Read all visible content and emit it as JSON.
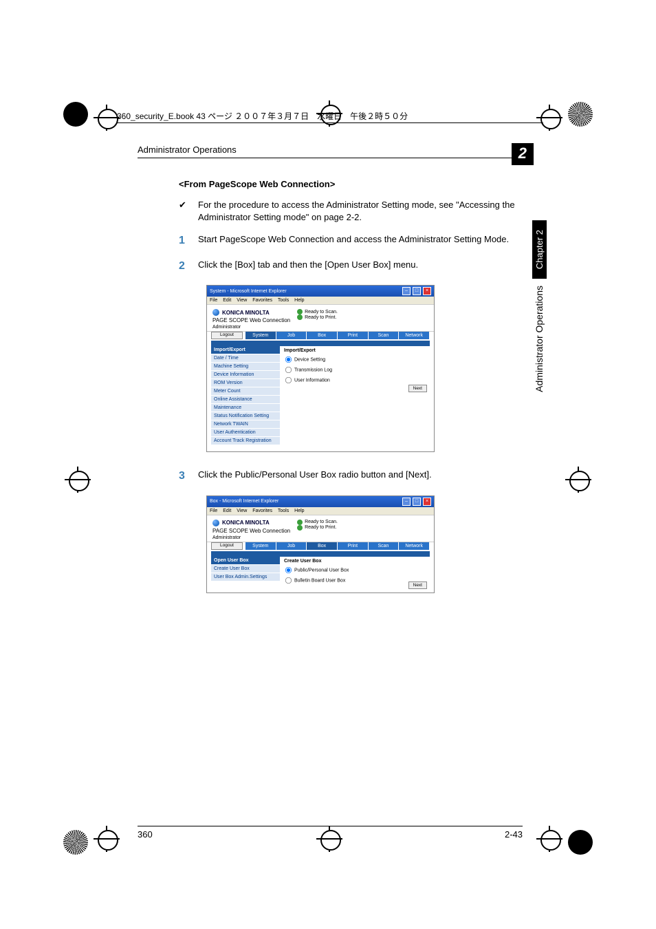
{
  "header_strip": "360_security_E.book  43 ページ  ２００７年３月７日　水曜日　午後２時５０分",
  "section_title": "Administrator Operations",
  "chapter_badge": "2",
  "sub_head": "<From PageScope Web Connection>",
  "bullets": [
    {
      "mark": "✔",
      "text": "For the procedure to access the Administrator Setting mode, see \"Accessing the Administrator Setting mode\" on page 2-2."
    },
    {
      "mark": "1",
      "text": "Start PageScope Web Connection and access the Administrator Setting Mode."
    },
    {
      "mark": "2",
      "text": "Click the [Box] tab and then the [Open User Box] menu."
    },
    {
      "mark": "3",
      "text": "Click the Public/Personal User Box radio button and [Next]."
    }
  ],
  "ie_menu": [
    "File",
    "Edit",
    "View",
    "Favorites",
    "Tools",
    "Help"
  ],
  "brand": {
    "name": "KONICA MINOLTA",
    "product": "PAGE SCOPE Web Connection",
    "role": "Administrator"
  },
  "status": {
    "scan": "Ready to Scan.",
    "print": "Ready to Print."
  },
  "logout": "Logout",
  "tabs": [
    "System",
    "Job",
    "Box",
    "Print",
    "Scan",
    "Network"
  ],
  "shot1": {
    "title": "System - Microsoft Internet Explorer",
    "active_tab": "System",
    "side_head": "Import/Export",
    "side_items": [
      "Date / Time",
      "Machine Setting",
      "Device Information",
      "ROM Version",
      "Meter Count",
      "Online Assistance",
      "Maintenance",
      "Status Notification Setting",
      "Network TWAIN",
      "User Authentication",
      "Account Track Registration"
    ],
    "panel_title": "Import/Export",
    "radios": [
      "Device Setting",
      "Transmission Log",
      "User Information"
    ],
    "next": "Next"
  },
  "shot2": {
    "title": "Box - Microsoft Internet Explorer",
    "active_tab": "Box",
    "side_items": [
      "Open User Box",
      "Create User Box",
      "User Box Admin.Settings"
    ],
    "panel_title": "Create User Box",
    "radios": [
      "Public/Personal User Box",
      "Bulletin Board User Box"
    ],
    "next": "Next"
  },
  "side_tab": {
    "chapter": "Chapter 2",
    "section": "Administrator Operations"
  },
  "footer": {
    "left": "360",
    "right": "2-43"
  }
}
